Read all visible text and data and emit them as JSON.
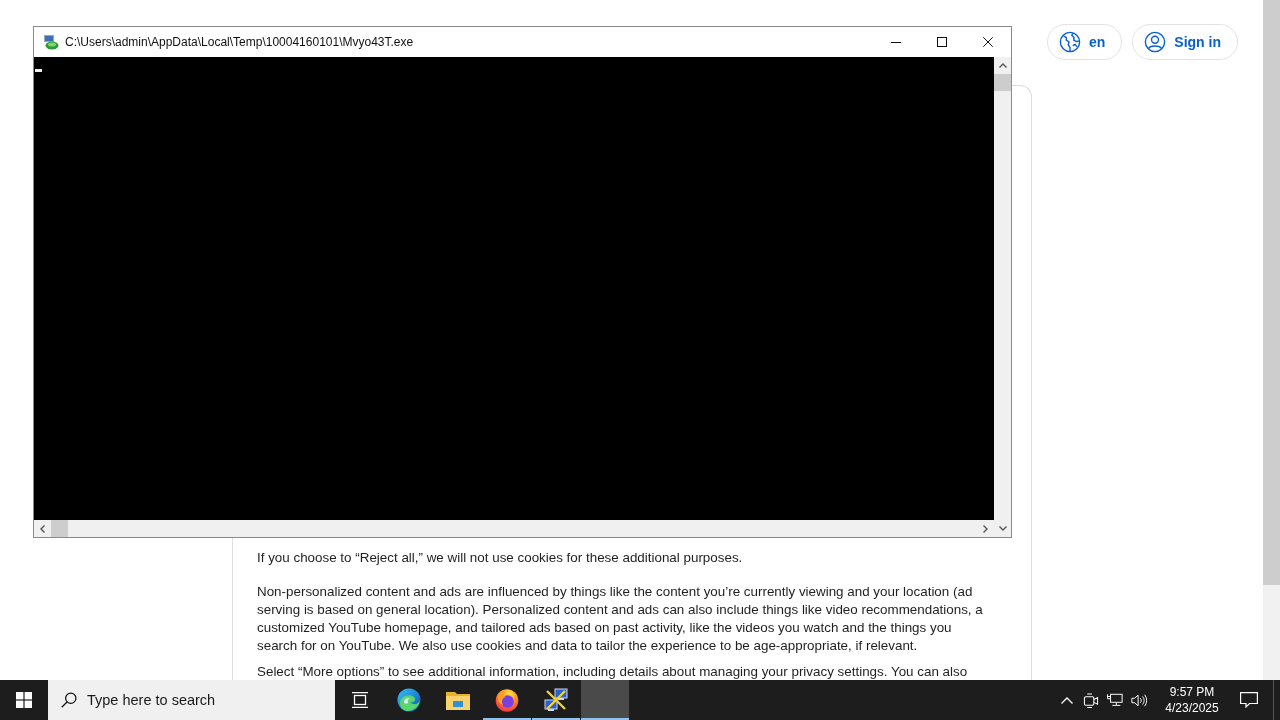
{
  "console_window": {
    "title": "C:\\Users\\admin\\AppData\\Local\\Temp\\10004160101\\Mvyo43T.exe"
  },
  "header": {
    "buttons": [
      {
        "kind": "language",
        "label": "en"
      },
      {
        "kind": "account",
        "label": "Sign in"
      }
    ]
  },
  "consent": {
    "paragraphs": [
      "If you choose to “Reject all,” we will not use cookies for these additional purposes.",
      "Non-personalized content and ads are influenced by things like the content you’re currently viewing and your location (ad serving is based on general location). Personalized content and ads can also include things like video recommendations, a customized YouTube homepage, and tailored ads based on past activity, like the videos you watch and the things you search for on YouTube. We also use cookies and data to tailor the experience to be age-appropriate, if relevant.",
      "Select “More options” to see additional information, including details about managing your privacy settings. You can also"
    ]
  },
  "taskbar": {
    "search": {
      "placeholder": "Type here to search"
    },
    "apps": [
      {
        "kind": "browser",
        "running": false,
        "selected": false
      },
      {
        "kind": "folder",
        "running": false,
        "selected": false
      },
      {
        "kind": "fox",
        "running": true,
        "selected": false
      },
      {
        "kind": "network-tool",
        "running": true,
        "selected": false
      },
      {
        "kind": "blank",
        "running": true,
        "selected": true
      }
    ],
    "tray": {
      "time": "9:57 PM",
      "date": "4/23/2025"
    }
  }
}
